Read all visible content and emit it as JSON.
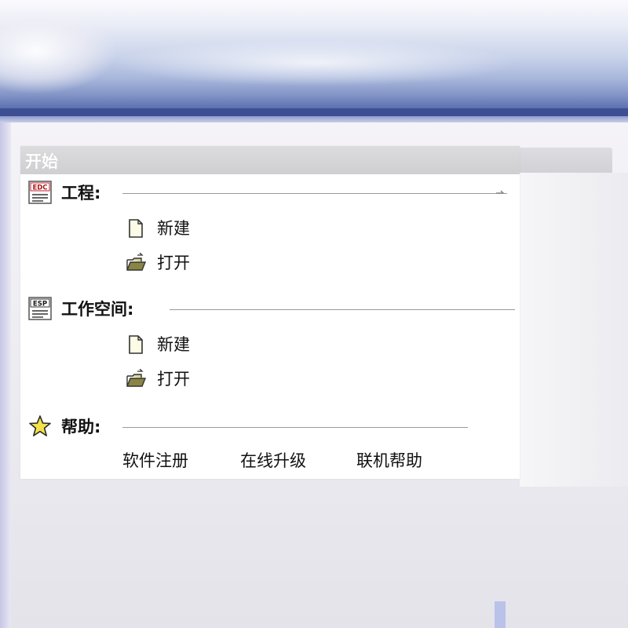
{
  "start_panel": {
    "title": "开始",
    "sections": [
      {
        "title": "工程:",
        "icon": "edc-project-icon",
        "icon_text": "EDC",
        "items": [
          {
            "label": "新建",
            "icon": "new-file-icon"
          },
          {
            "label": "打开",
            "icon": "open-folder-icon"
          }
        ]
      },
      {
        "title": "工作空间:",
        "icon": "esp-workspace-icon",
        "icon_text": "ESP",
        "items": [
          {
            "label": "新建",
            "icon": "new-file-icon"
          },
          {
            "label": "打开",
            "icon": "open-folder-icon"
          }
        ]
      }
    ],
    "help": {
      "title": "帮助:",
      "icon": "star-icon",
      "links": [
        "软件注册",
        "在线升级",
        "联机帮助"
      ]
    }
  },
  "colors": {
    "panel_header_bg": "#d5d5d8",
    "panel_bg": "#ffffff",
    "sky_band": "#3d4f92",
    "star_fill": "#f4e14a"
  }
}
